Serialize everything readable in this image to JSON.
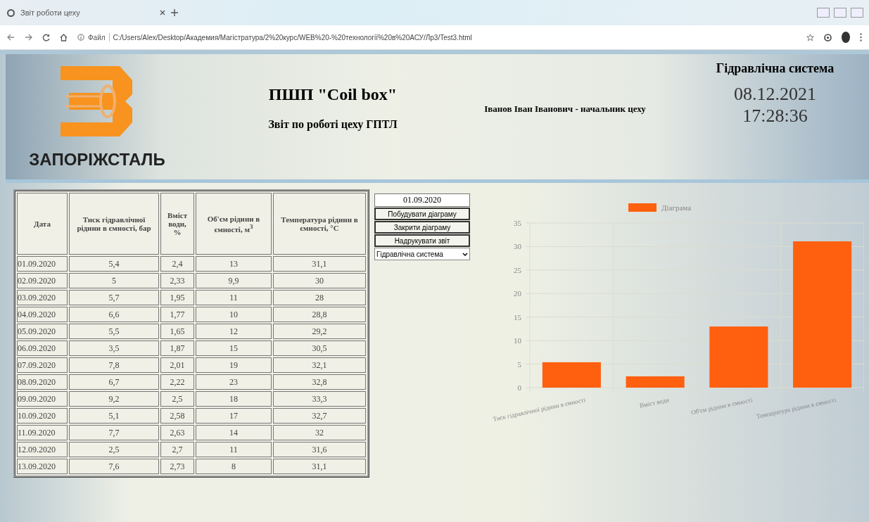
{
  "browser": {
    "tab_title": "Звіт роботи цеху",
    "address_label": "Файл",
    "url": "C:/Users/Alex/Desktop/Академия/Магістратура/2%20курс/WEB%20-%20технології%20в%20АСУ/Лр3/Test3.html"
  },
  "header": {
    "logo_text": "ЗАПОРІЖСТАЛЬ",
    "company": "ПШП \"Coil box\"",
    "report_title": "Звіт по роботі цеху ГПТЛ",
    "person": "Іванов Іван Іванович - начальник цеху",
    "system": "Гідравлічна система",
    "date": "08.12.2021",
    "time": "17:28:36"
  },
  "table": {
    "columns": [
      "Дата",
      "Тиск гідравлічної рідини в ємності, бар",
      "Вміст води, %",
      "Об'єм рідини в ємності, м$^{3}$",
      "Температура рідини в ємності, °С"
    ],
    "rows": [
      [
        "01.09.2020",
        "5,4",
        "2,4",
        "13",
        "31,1"
      ],
      [
        "02.09.2020",
        "5",
        "2,33",
        "9,9",
        "30"
      ],
      [
        "03.09.2020",
        "5,7",
        "1,95",
        "11",
        "28"
      ],
      [
        "04.09.2020",
        "6,6",
        "1,77",
        "10",
        "28,8"
      ],
      [
        "05.09.2020",
        "5,5",
        "1,65",
        "12",
        "29,2"
      ],
      [
        "06.09.2020",
        "3,5",
        "1,87",
        "15",
        "30,5"
      ],
      [
        "07.09.2020",
        "7,8",
        "2,01",
        "19",
        "32,1"
      ],
      [
        "08.09.2020",
        "6,7",
        "2,22",
        "23",
        "32,8"
      ],
      [
        "09.09.2020",
        "9,2",
        "2,5",
        "18",
        "33,3"
      ],
      [
        "10.09.2020",
        "5,1",
        "2,58",
        "17",
        "32,7"
      ],
      [
        "11.09.2020",
        "7,7",
        "2,63",
        "14",
        "32"
      ],
      [
        "12.09.2020",
        "2,5",
        "2,7",
        "11",
        "31,6"
      ],
      [
        "13.09.2020",
        "7,6",
        "2,73",
        "8",
        "31,1"
      ]
    ]
  },
  "controls": {
    "date_value": "01.09.2020",
    "buttons": [
      "Побудувати діаграму",
      "Закрити діаграму",
      "Надрукувати звіт"
    ],
    "system_select": "Гідравлічна система"
  },
  "chart_data": {
    "type": "bar",
    "categories": [
      "Тиск гідравлічної рідини в ємності",
      "Вміст води",
      "Об'єм рідини в ємності",
      "Температура рідини в ємності"
    ],
    "series": [
      {
        "name": "Діаграма",
        "color": "#ff6010",
        "values": [
          5.4,
          2.4,
          13,
          31.1
        ]
      }
    ],
    "ylim": [
      0,
      35
    ],
    "grid": true,
    "yticks": [
      0,
      5,
      10,
      15,
      20,
      25,
      30,
      35
    ]
  }
}
